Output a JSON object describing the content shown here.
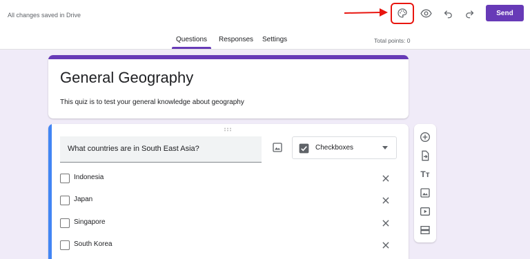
{
  "header": {
    "saved_status": "All changes saved in Drive",
    "send_label": "Send",
    "icons": [
      "palette-icon",
      "eye-icon",
      "undo-icon",
      "redo-icon"
    ]
  },
  "tabs": [
    {
      "label": "Questions",
      "active": true
    },
    {
      "label": "Responses",
      "active": false
    },
    {
      "label": "Settings",
      "active": false
    }
  ],
  "total_points": "Total points: 0",
  "form": {
    "title": "General Geography",
    "description": "This quiz is to test your general knowledge about geography"
  },
  "question": {
    "text": "What countries are in South East Asia?",
    "type": "Checkboxes",
    "options": [
      "Indonesia",
      "Japan",
      "Singapore",
      "South Korea"
    ]
  },
  "side_toolbar": {
    "items": [
      "add-question-icon",
      "import-questions-icon",
      "add-title-icon",
      "add-image-icon",
      "add-video-icon",
      "add-section-icon"
    ],
    "title_glyph": "Tт"
  },
  "colors": {
    "accent": "#673ab7",
    "active_question": "#4285f4",
    "background": "#f0ebf8",
    "annotation": "#e8150f"
  }
}
